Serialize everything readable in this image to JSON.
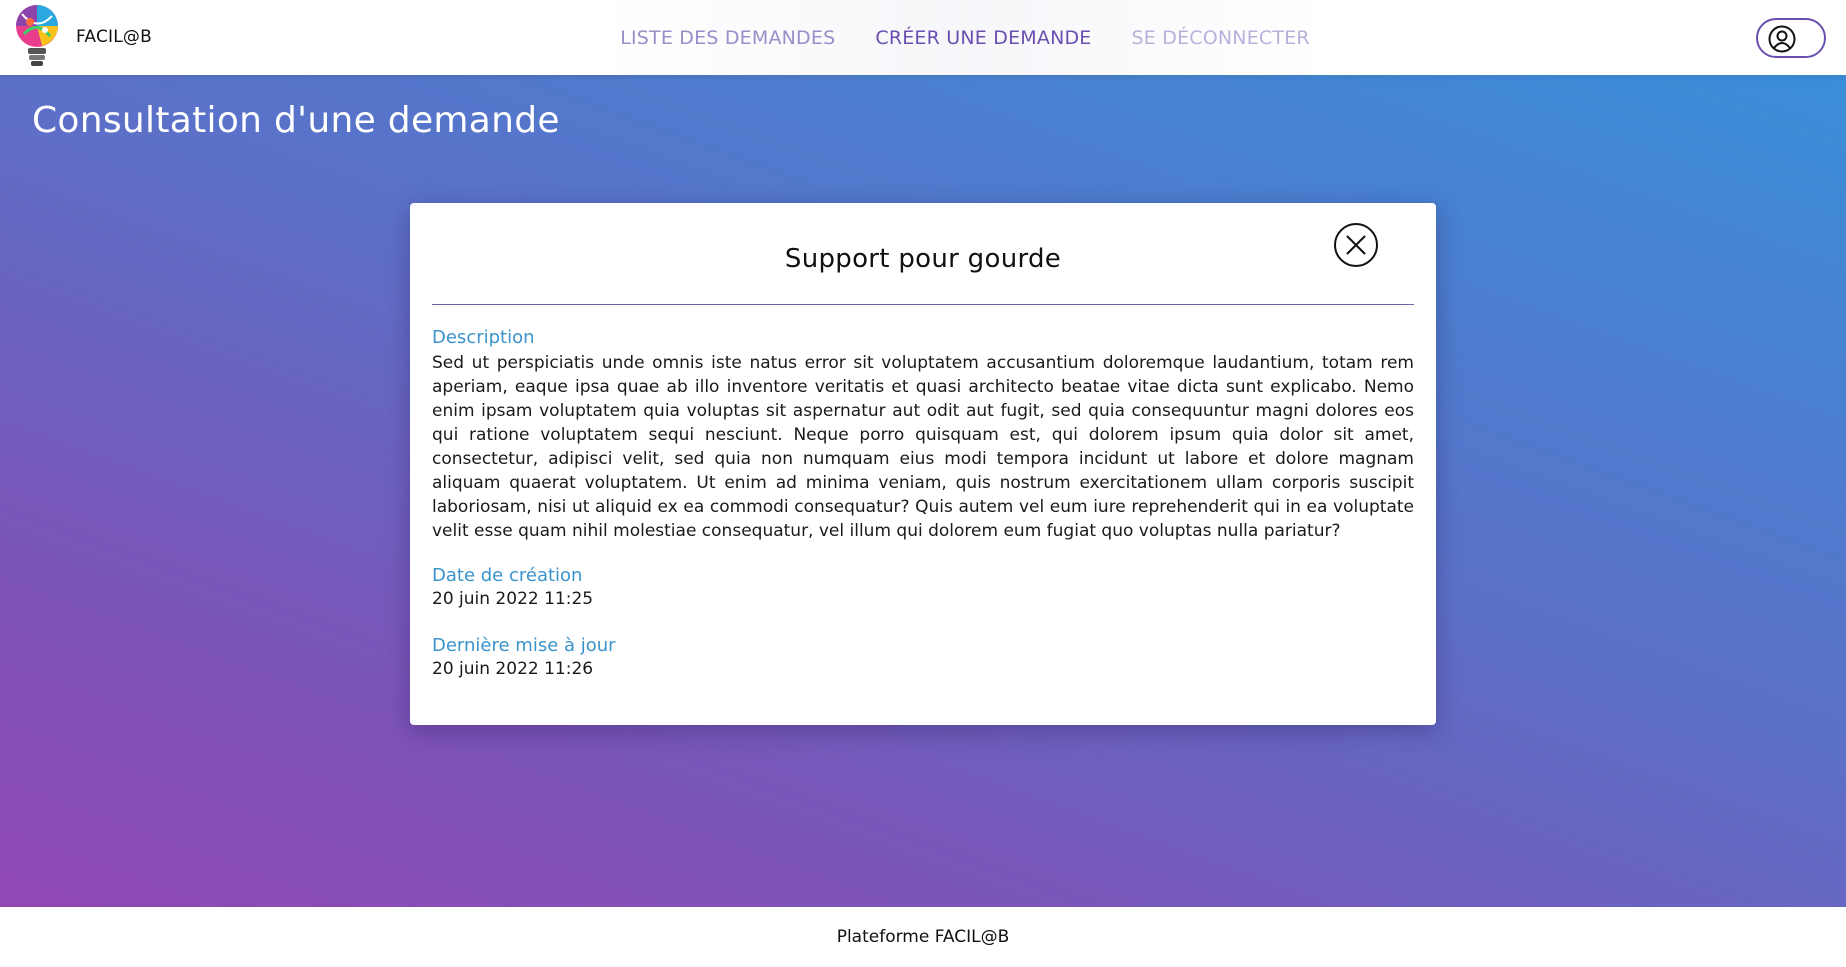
{
  "header": {
    "brand_name": "FACIL@B",
    "nav": {
      "requests_list": "LISTE DES DEMANDES",
      "create_request": "CRÉER UNE DEMANDE",
      "logout": "SE DÉCONNECTER"
    },
    "user_icon": "user-circle-icon"
  },
  "main": {
    "page_title": "Consultation d'une demande"
  },
  "modal": {
    "title": "Support pour gourde",
    "close_icon": "close-circle-icon",
    "description_label": "Description",
    "description_text": "Sed ut perspiciatis unde omnis iste natus error sit voluptatem accusantium doloremque laudantium, totam rem aperiam, eaque ipsa quae ab illo inventore veritatis et quasi architecto beatae vitae dicta sunt explicabo. Nemo enim ipsam voluptatem quia voluptas sit aspernatur aut odit aut fugit, sed quia consequuntur magni dolores eos qui ratione voluptatem sequi nesciunt. Neque porro quisquam est, qui dolorem ipsum quia dolor sit amet, consectetur, adipisci velit, sed quia non numquam eius modi tempora incidunt ut labore et dolore magnam aliquam quaerat voluptatem. Ut enim ad minima veniam, quis nostrum exercitationem ullam corporis suscipit laboriosam, nisi ut aliquid ex ea commodi consequatur? Quis autem vel eum iure reprehenderit qui in ea voluptate velit esse quam nihil molestiae consequatur, vel illum qui dolorem eum fugiat quo voluptas nulla pariatur?",
    "created_label": "Date de création",
    "created_value": "20 juin 2022 11:25",
    "updated_label": "Dernière mise à jour",
    "updated_value": "20 juin 2022 11:26"
  },
  "footer": {
    "text": "Plateforme FACIL@B"
  },
  "colors": {
    "accent": "#6a4fb0",
    "label_blue": "#3b93cc",
    "gradient_start": "#9048b4",
    "gradient_end": "#3a8ed8"
  }
}
